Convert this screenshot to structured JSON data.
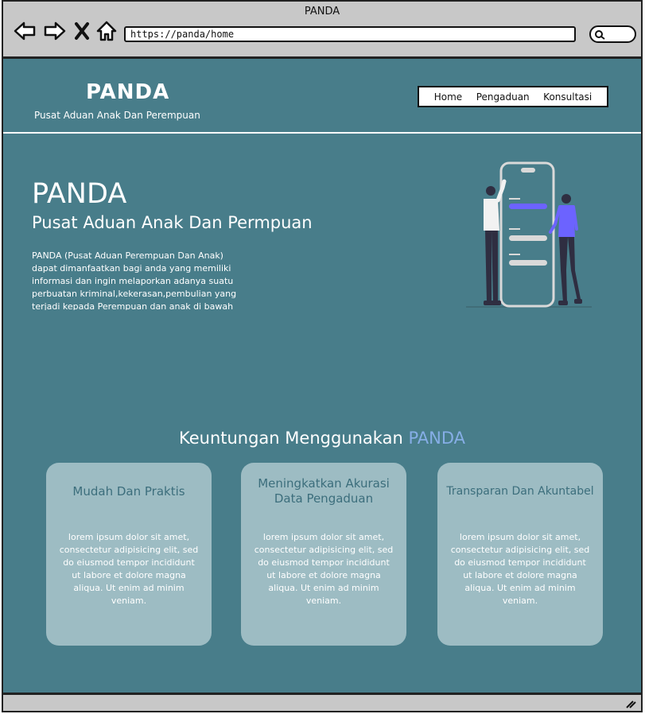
{
  "window": {
    "title": "PANDA"
  },
  "browser": {
    "url": "https://panda/home",
    "icons": [
      "back-arrow-icon",
      "forward-arrow-icon",
      "close-icon",
      "home-icon",
      "search-icon"
    ]
  },
  "header": {
    "logo": "PANDA",
    "tagline": "Pusat Aduan Anak Dan Perempuan",
    "nav": [
      {
        "label": "Home"
      },
      {
        "label": "Pengaduan"
      },
      {
        "label": "Konsultasi"
      }
    ]
  },
  "hero": {
    "title": "PANDA",
    "subtitle": "Pusat Aduan Anak Dan Permpuan",
    "text": "PANDA (Pusat Aduan Perempuan Dan Anak) dapat dimanfaatkan bagi anda yang memiliki informasi dan ingin melaporkan adanya suatu perbuatan kriminal,kekerasan,pembulian yang terjadi kepada Perempuan dan anak di bawah"
  },
  "benefits": {
    "title_prefix": "Keuntungan Menggunakan ",
    "title_accent": "PANDA",
    "cards": [
      {
        "title": "Mudah Dan Praktis",
        "text": "lorem ipsum dolor sit amet, consectetur adipisicing elit, sed do eiusmod tempor incididunt ut labore et dolore magna aliqua. Ut enim ad minim veniam."
      },
      {
        "title": "Meningkatkan Akurasi Data Pengaduan",
        "text": "lorem ipsum dolor sit amet, consectetur adipisicing elit, sed do eiusmod tempor incididunt ut labore et dolore magna aliqua. Ut enim ad minim veniam."
      },
      {
        "title": "Transparan Dan Akuntabel",
        "text": "lorem ipsum dolor sit amet, consectetur adipisicing elit, sed do eiusmod tempor incididunt ut labore et dolore magna aliqua. Ut enim ad minim veniam."
      }
    ]
  },
  "colors": {
    "page_bg": "#487d8a",
    "card_bg": "#9dbcc3",
    "card_title": "#3c6e7c",
    "accent": "#86aee6",
    "illustration_purple": "#6c63ff"
  }
}
